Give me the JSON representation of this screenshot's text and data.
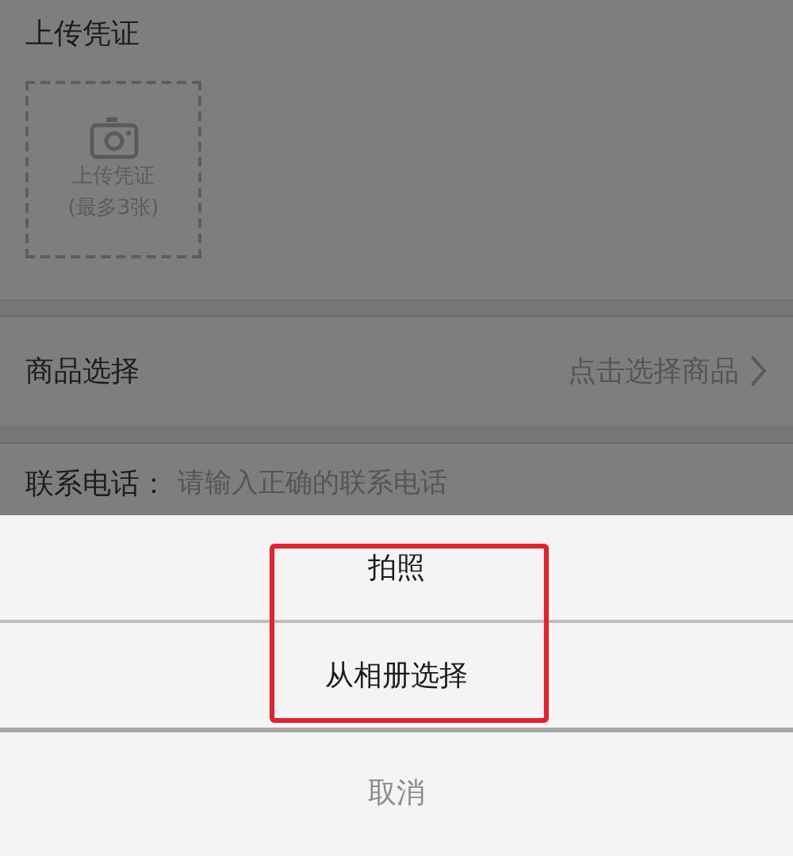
{
  "upload": {
    "title": "上传凭证",
    "tile_label": "上传凭证",
    "tile_hint": "(最多3张)"
  },
  "product_row": {
    "label": "商品选择",
    "value": "点击选择商品"
  },
  "phone_row": {
    "label": "联系电话：",
    "placeholder": "请输入正确的联系电话"
  },
  "action_sheet": {
    "items": [
      {
        "label": "拍照"
      },
      {
        "label": "从相册选择"
      }
    ],
    "cancel": "取消"
  }
}
